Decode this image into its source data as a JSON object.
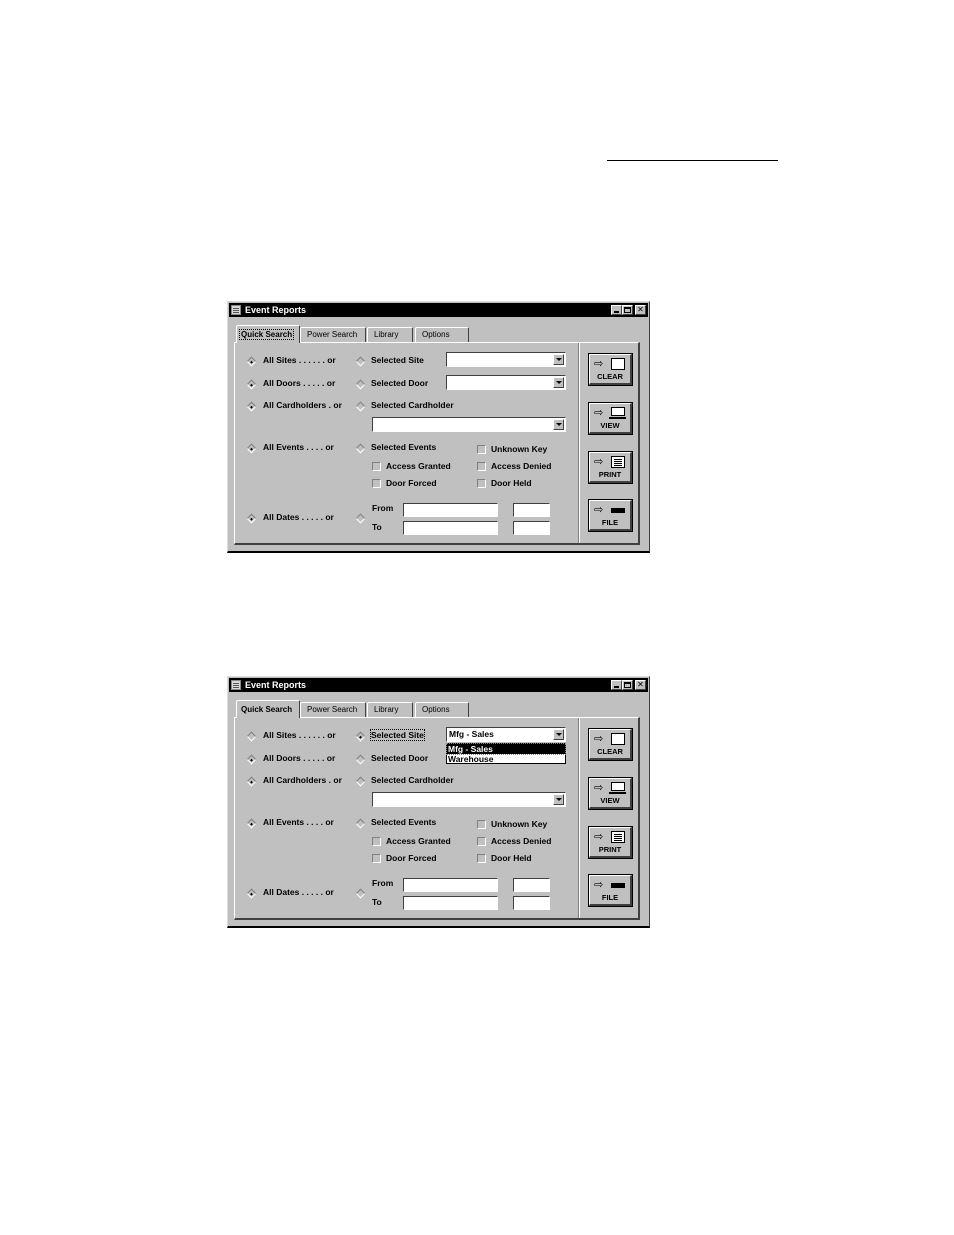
{
  "windows": [
    {
      "title": "Event Reports",
      "tabs": [
        "Quick Search",
        "Power Search",
        "Library",
        "Options"
      ],
      "active_tab": "Quick Search",
      "rows": {
        "sites": {
          "all_label": "All Sites . . . . . . or",
          "sel_label": "Selected Site",
          "all_selected": true,
          "combo_value": ""
        },
        "doors": {
          "all_label": "All Doors . . . . .  or",
          "sel_label": "Selected Door",
          "all_selected": true,
          "combo_value": ""
        },
        "cardholders": {
          "all_label": "All Cardholders . or",
          "sel_label": "Selected Cardholder",
          "all_selected": true,
          "combo_value": ""
        },
        "events": {
          "all_label": "All Events . . . .  or",
          "sel_label": "Selected Events",
          "all_selected": true
        },
        "dates": {
          "all_label": "All Dates . . . . . or",
          "all_selected": true,
          "from_label": "From",
          "to_label": "To"
        }
      },
      "event_checkboxes": [
        "Unknown Key",
        "Access Granted",
        "Access Denied",
        "Door Forced",
        "Door Held"
      ],
      "action_buttons": [
        "CLEAR",
        "VIEW",
        "PRINT",
        "FILE"
      ]
    },
    {
      "title": "Event Reports",
      "tabs": [
        "Quick Search",
        "Power Search",
        "Library",
        "Options"
      ],
      "active_tab": "Quick Search",
      "rows": {
        "sites": {
          "all_label": "All Sites . . . . . . or",
          "sel_label": "Selected Site",
          "all_selected": false,
          "combo_value": "Mfg - Sales"
        },
        "doors": {
          "all_label": "All Doors . . . . .  or",
          "sel_label": "Selected Door",
          "all_selected": true,
          "combo_value": ""
        },
        "cardholders": {
          "all_label": "All Cardholders . or",
          "sel_label": "Selected Cardholder",
          "all_selected": true,
          "combo_value": ""
        },
        "events": {
          "all_label": "All Events . . . .  or",
          "sel_label": "Selected Events",
          "all_selected": true
        },
        "dates": {
          "all_label": "All Dates . . . . . or",
          "all_selected": true,
          "from_label": "From",
          "to_label": "To"
        }
      },
      "site_dropdown_options": [
        "Mfg - Sales",
        "Warehouse"
      ],
      "site_dropdown_highlighted": "Mfg - Sales",
      "event_checkboxes": [
        "Unknown Key",
        "Access Granted",
        "Access Denied",
        "Door Forced",
        "Door Held"
      ],
      "action_buttons": [
        "CLEAR",
        "VIEW",
        "PRINT",
        "FILE"
      ]
    }
  ]
}
